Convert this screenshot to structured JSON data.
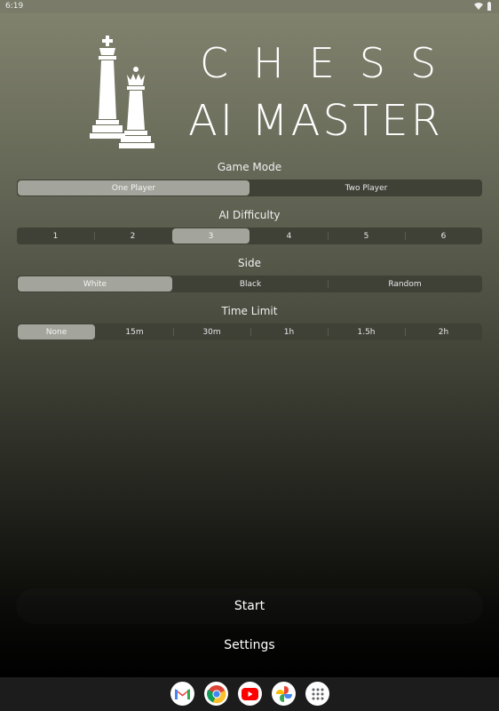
{
  "status_bar": {
    "time": "6:19"
  },
  "title": {
    "line1": "CHESS",
    "line2": "AI MASTER"
  },
  "game_mode": {
    "label": "Game Mode",
    "options": [
      "One Player",
      "Two Player"
    ],
    "selected": "One Player"
  },
  "ai_difficulty": {
    "label": "AI Difficulty",
    "options": [
      "1",
      "2",
      "3",
      "4",
      "5",
      "6"
    ],
    "selected": "3"
  },
  "side": {
    "label": "Side",
    "options": [
      "White",
      "Black",
      "Random"
    ],
    "selected": "White"
  },
  "time_limit": {
    "label": "Time Limit",
    "options": [
      "None",
      "15m",
      "30m",
      "1h",
      "1.5h",
      "2h"
    ],
    "selected": "None"
  },
  "actions": {
    "start": "Start",
    "settings": "Settings"
  },
  "dock": {
    "apps": [
      "gmail-icon",
      "chrome-icon",
      "youtube-icon",
      "photos-icon",
      "app-drawer-icon"
    ]
  },
  "colors": {
    "selected_segment": "#a3a49b",
    "segment_bg": "#3f4137"
  }
}
